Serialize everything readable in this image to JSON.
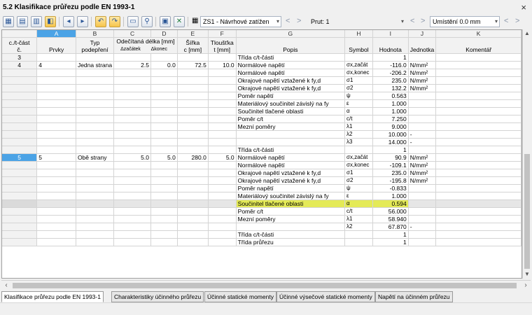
{
  "window": {
    "title": "5.2 Klasifikace průřezu podle EN 1993-1",
    "close": "×"
  },
  "toolbar": {
    "load_case_combo": "ZS1 - Návrhové zatížen",
    "member_combo": "Prut: 1",
    "location_combo": "Umístění 0.0 mm",
    "nav_prev": "<",
    "nav_next": ">",
    "dropdown_arrow": "▾"
  },
  "columns": {
    "letters": [
      "A",
      "B",
      "C",
      "D",
      "E",
      "F",
      "G",
      "H",
      "I",
      "J",
      "K"
    ],
    "rowhead_top": "c./t-část",
    "rowhead_bottom": "č.",
    "headers": [
      {
        "top": "",
        "bottom": "Prvky"
      },
      {
        "top": "Typ",
        "bottom": "podepření"
      },
      {
        "top": "Odečítaná délka [mm]",
        "bottom": "Δzačátek"
      },
      {
        "top": "",
        "bottom": "Δkonec"
      },
      {
        "top": "Šířka",
        "bottom": "c [mm]"
      },
      {
        "top": "Tloušťka",
        "bottom": "t [mm]"
      },
      {
        "top": "",
        "bottom": "Popis"
      },
      {
        "top": "",
        "bottom": "Symbol"
      },
      {
        "top": "",
        "bottom": "Hodnota"
      },
      {
        "top": "",
        "bottom": "Jednotka"
      },
      {
        "top": "",
        "bottom": "Komentář"
      }
    ]
  },
  "rows": [
    {
      "n": "3",
      "a": "",
      "b": "",
      "c": "",
      "d": "",
      "e": "",
      "f": "",
      "g": "Třída c/t-části",
      "h": "",
      "i": "1",
      "j": "",
      "k": ""
    },
    {
      "n": "4",
      "a": "4",
      "b": "Jedna strana",
      "c": "2.5",
      "d": "0.0",
      "e": "72.5",
      "f": "10.0",
      "g": "Normálové napětí",
      "h": "σx,začát",
      "i": "-116.0",
      "j": "N/mm²",
      "k": ""
    },
    {
      "n": "",
      "a": "",
      "b": "",
      "c": "",
      "d": "",
      "e": "",
      "f": "",
      "g": "Normálové napětí",
      "h": "σx,konec",
      "i": "-206.2",
      "j": "N/mm²",
      "k": ""
    },
    {
      "n": "",
      "a": "",
      "b": "",
      "c": "",
      "d": "",
      "e": "",
      "f": "",
      "g": "Okrajové napětí vztažené k fy,d",
      "h": "σ1",
      "i": "235.0",
      "j": "N/mm²",
      "k": ""
    },
    {
      "n": "",
      "a": "",
      "b": "",
      "c": "",
      "d": "",
      "e": "",
      "f": "",
      "g": "Okrajové napětí vztažené k fy,d",
      "h": "σ2",
      "i": "132.2",
      "j": "N/mm²",
      "k": ""
    },
    {
      "n": "",
      "a": "",
      "b": "",
      "c": "",
      "d": "",
      "e": "",
      "f": "",
      "g": "Poměr napětí",
      "h": "ψ",
      "i": "0.563",
      "j": "",
      "k": ""
    },
    {
      "n": "",
      "a": "",
      "b": "",
      "c": "",
      "d": "",
      "e": "",
      "f": "",
      "g": "Materiálový součinitel závislý na fy",
      "h": "ε",
      "i": "1.000",
      "j": "",
      "k": ""
    },
    {
      "n": "",
      "a": "",
      "b": "",
      "c": "",
      "d": "",
      "e": "",
      "f": "",
      "g": "Součinitel tlačené oblasti",
      "h": "α",
      "i": "1.000",
      "j": "",
      "k": ""
    },
    {
      "n": "",
      "a": "",
      "b": "",
      "c": "",
      "d": "",
      "e": "",
      "f": "",
      "g": "Poměr c/t",
      "h": "c/t",
      "i": "7.250",
      "j": "",
      "k": ""
    },
    {
      "n": "",
      "a": "",
      "b": "",
      "c": "",
      "d": "",
      "e": "",
      "f": "",
      "g": "Mezní poměry",
      "h": "λ1",
      "i": "9.000",
      "j": "",
      "k": ""
    },
    {
      "n": "",
      "a": "",
      "b": "",
      "c": "",
      "d": "",
      "e": "",
      "f": "",
      "g": "",
      "h": "λ2",
      "i": "10.000",
      "j": "-",
      "k": ""
    },
    {
      "n": "",
      "a": "",
      "b": "",
      "c": "",
      "d": "",
      "e": "",
      "f": "",
      "g": "",
      "h": "λ3",
      "i": "14.000",
      "j": "-",
      "k": ""
    },
    {
      "n": "",
      "a": "",
      "b": "",
      "c": "",
      "d": "",
      "e": "",
      "f": "",
      "g": "Třída c/t-části",
      "h": "",
      "i": "1",
      "j": "",
      "k": ""
    },
    {
      "n": "5",
      "a": "5",
      "b": "Obě strany",
      "c": "5.0",
      "d": "5.0",
      "e": "280.0",
      "f": "5.0",
      "g": "Normálové napětí",
      "h": "σx,začát",
      "i": "90.9",
      "j": "N/mm²",
      "k": ""
    },
    {
      "n": "",
      "a": "",
      "b": "",
      "c": "",
      "d": "",
      "e": "",
      "f": "",
      "g": "Normálové napětí",
      "h": "σx,konec",
      "i": "-109.1",
      "j": "N/mm²",
      "k": ""
    },
    {
      "n": "",
      "a": "",
      "b": "",
      "c": "",
      "d": "",
      "e": "",
      "f": "",
      "g": "Okrajové napětí vztažené k fy,d",
      "h": "σ1",
      "i": "235.0",
      "j": "N/mm²",
      "k": ""
    },
    {
      "n": "",
      "a": "",
      "b": "",
      "c": "",
      "d": "",
      "e": "",
      "f": "",
      "g": "Okrajové napětí vztažené k fy,d",
      "h": "σ2",
      "i": "-195.8",
      "j": "N/mm²",
      "k": ""
    },
    {
      "n": "",
      "a": "",
      "b": "",
      "c": "",
      "d": "",
      "e": "",
      "f": "",
      "g": "Poměr napětí",
      "h": "ψ",
      "i": "-0.833",
      "j": "",
      "k": ""
    },
    {
      "n": "",
      "a": "",
      "b": "",
      "c": "",
      "d": "",
      "e": "",
      "f": "",
      "g": "Materiálový součinitel závislý na fy",
      "h": "ε",
      "i": "1.000",
      "j": "",
      "k": ""
    },
    {
      "n": "",
      "a": "",
      "b": "",
      "c": "",
      "d": "",
      "e": "",
      "f": "",
      "g": "Součinitel tlačené oblasti",
      "h": "α",
      "i": "0.594",
      "j": "",
      "k": "",
      "grey": true,
      "highlight": true
    },
    {
      "n": "",
      "a": "",
      "b": "",
      "c": "",
      "d": "",
      "e": "",
      "f": "",
      "g": "Poměr c/t",
      "h": "c/t",
      "i": "56.000",
      "j": "",
      "k": ""
    },
    {
      "n": "",
      "a": "",
      "b": "",
      "c": "",
      "d": "",
      "e": "",
      "f": "",
      "g": "Mezní poměry",
      "h": "λ1",
      "i": "58.940",
      "j": "",
      "k": ""
    },
    {
      "n": "",
      "a": "",
      "b": "",
      "c": "",
      "d": "",
      "e": "",
      "f": "",
      "g": "",
      "h": "λ2",
      "i": "67.870",
      "j": "-",
      "k": ""
    },
    {
      "n": "",
      "a": "",
      "b": "",
      "c": "",
      "d": "",
      "e": "",
      "f": "",
      "g": "Třída c/t-části",
      "h": "",
      "i": "1",
      "j": "",
      "k": ""
    },
    {
      "n": "",
      "a": "",
      "b": "",
      "c": "",
      "d": "",
      "e": "",
      "f": "",
      "g": "Třída průřezu",
      "h": "",
      "i": "1",
      "j": "",
      "k": ""
    }
  ],
  "tabs": [
    "Klasifikace průřezu podle EN 1993-1",
    "Charakteristiky účinného průřezu",
    "Účinné statické momenty",
    "Účinné výsečové statické momenty",
    "Napětí na účinném průřezu"
  ],
  "colors": {
    "selection": "#4ba3e6",
    "highlight": "#e4ea57",
    "grey_row": "#e6e6e6"
  },
  "icons": [
    "table-icon",
    "results-icon",
    "export-icon",
    "filter-icon",
    "arrow-left-icon",
    "arrow-right-icon",
    "undo-icon",
    "view-icon",
    "settings-icon",
    "graphics-icon",
    "excel-icon",
    "calculator-icon"
  ]
}
